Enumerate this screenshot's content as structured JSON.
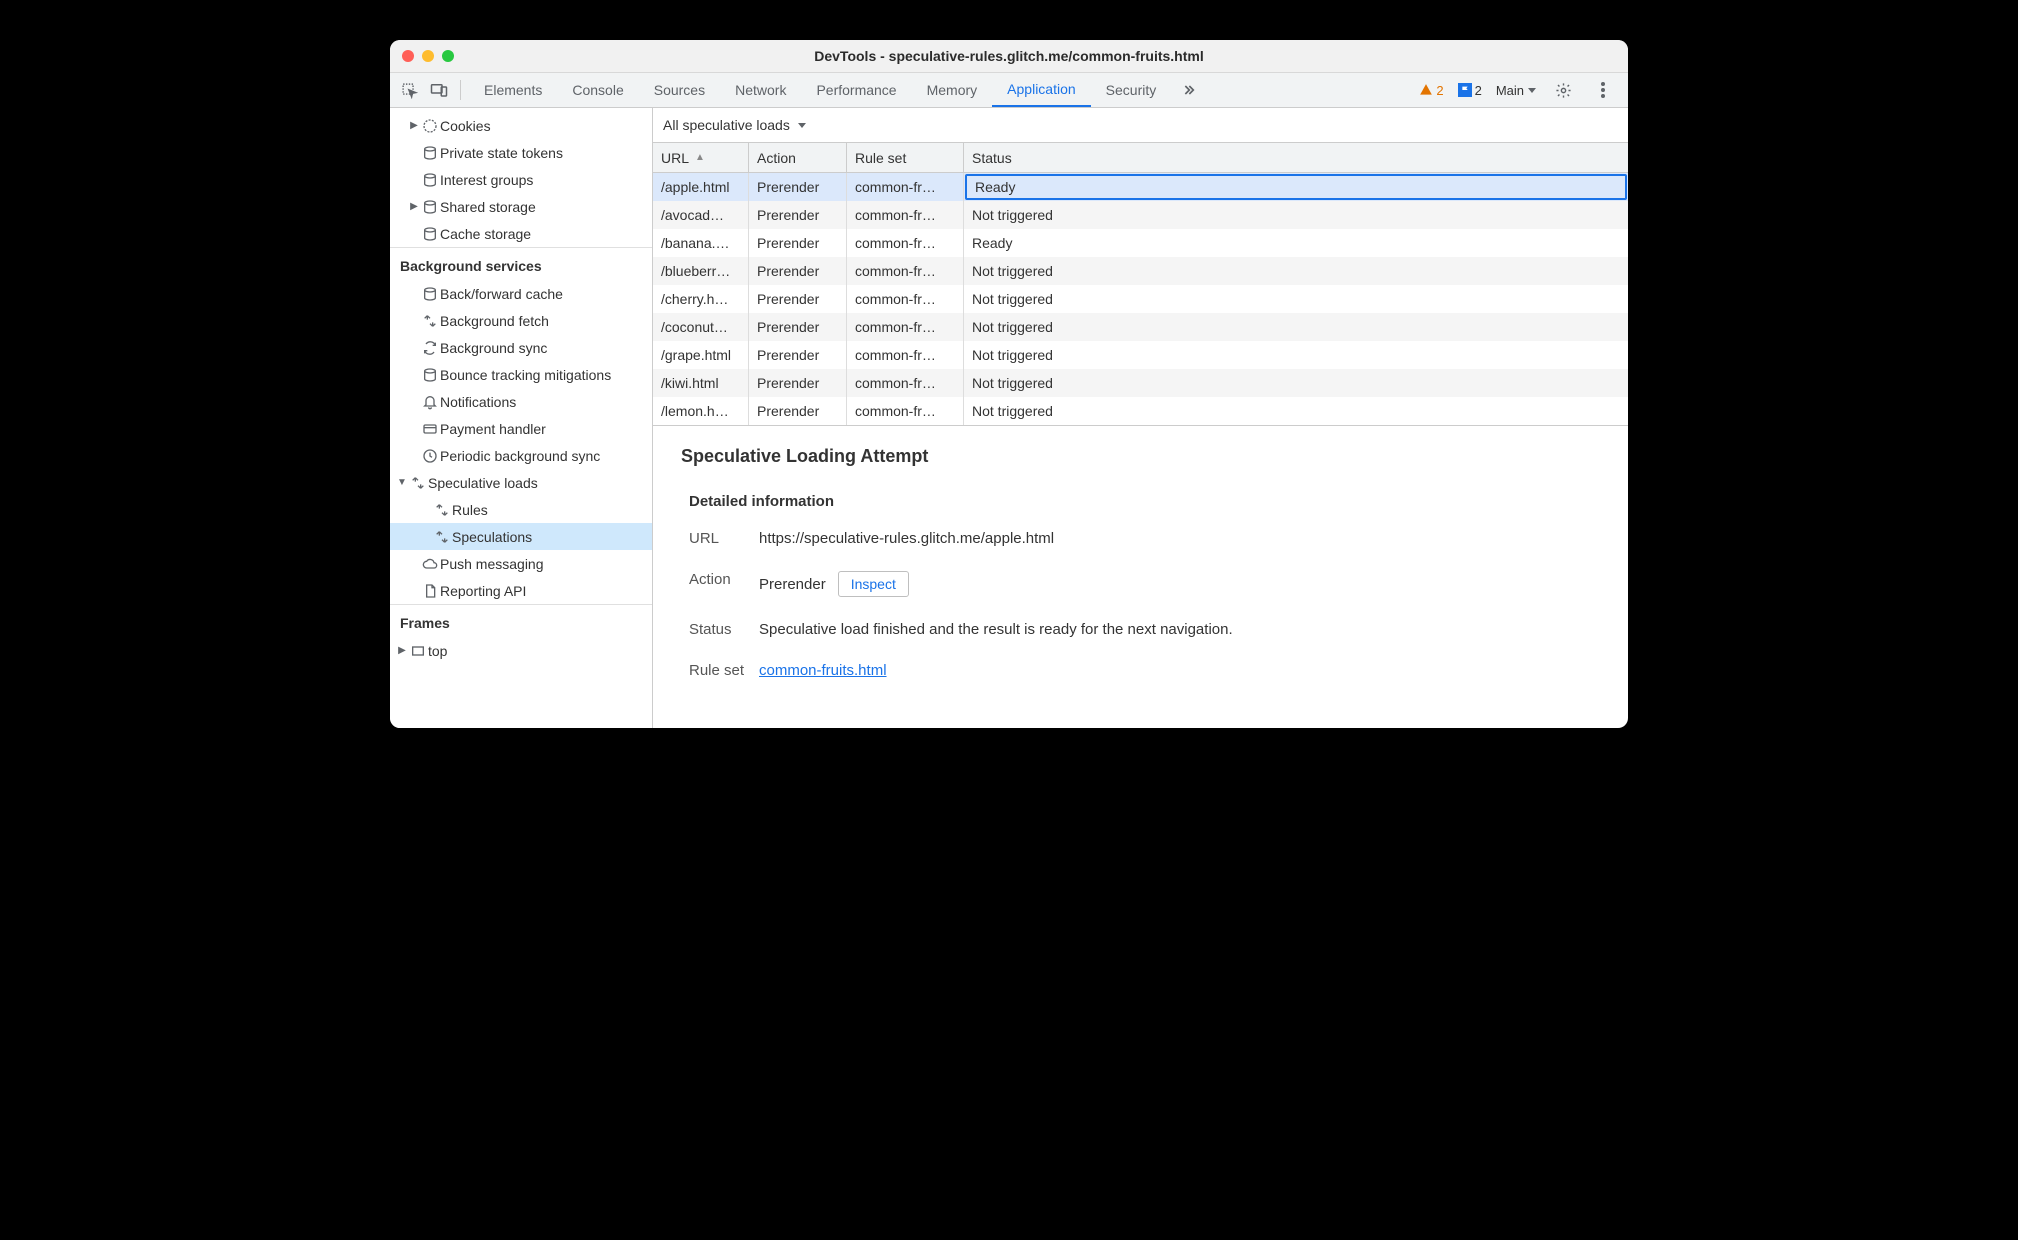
{
  "window": {
    "title": "DevTools - speculative-rules.glitch.me/common-fruits.html"
  },
  "tabbar": {
    "tabs": [
      "Elements",
      "Console",
      "Sources",
      "Network",
      "Performance",
      "Memory",
      "Application",
      "Security"
    ],
    "active_index": 6,
    "warnings_count": "2",
    "issues_count": "2",
    "target": "Main"
  },
  "sidebar": {
    "storage": {
      "cookies": "Cookies",
      "pst": "Private state tokens",
      "interest": "Interest groups",
      "shared": "Shared storage",
      "cache": "Cache storage"
    },
    "bg_header": "Background services",
    "bg": {
      "bfcache": "Back/forward cache",
      "bgfetch": "Background fetch",
      "bgsync": "Background sync",
      "bounce": "Bounce tracking mitigations",
      "notif": "Notifications",
      "payment": "Payment handler",
      "periodic": "Periodic background sync",
      "specloads": "Speculative loads",
      "rules": "Rules",
      "speculations": "Speculations",
      "push": "Push messaging",
      "reporting": "Reporting API"
    },
    "frames_header": "Frames",
    "frames_top": "top"
  },
  "filter": {
    "label": "All speculative loads"
  },
  "table": {
    "columns": {
      "url": "URL",
      "action": "Action",
      "ruleset": "Rule set",
      "status": "Status"
    },
    "rows": [
      {
        "url": "/apple.html",
        "action": "Prerender",
        "ruleset": "common-fr…",
        "status": "Ready",
        "selected": true
      },
      {
        "url": "/avocad…",
        "action": "Prerender",
        "ruleset": "common-fr…",
        "status": "Not triggered"
      },
      {
        "url": "/banana.…",
        "action": "Prerender",
        "ruleset": "common-fr…",
        "status": "Ready"
      },
      {
        "url": "/blueberr…",
        "action": "Prerender",
        "ruleset": "common-fr…",
        "status": "Not triggered"
      },
      {
        "url": "/cherry.h…",
        "action": "Prerender",
        "ruleset": "common-fr…",
        "status": "Not triggered"
      },
      {
        "url": "/coconut…",
        "action": "Prerender",
        "ruleset": "common-fr…",
        "status": "Not triggered"
      },
      {
        "url": "/grape.html",
        "action": "Prerender",
        "ruleset": "common-fr…",
        "status": "Not triggered"
      },
      {
        "url": "/kiwi.html",
        "action": "Prerender",
        "ruleset": "common-fr…",
        "status": "Not triggered"
      },
      {
        "url": "/lemon.h…",
        "action": "Prerender",
        "ruleset": "common-fr…",
        "status": "Not triggered"
      }
    ]
  },
  "details": {
    "heading": "Speculative Loading Attempt",
    "subheading": "Detailed information",
    "url_label": "URL",
    "url_value": "https://speculative-rules.glitch.me/apple.html",
    "action_label": "Action",
    "action_value": "Prerender",
    "inspect_btn": "Inspect",
    "status_label": "Status",
    "status_value": "Speculative load finished and the result is ready for the next navigation.",
    "ruleset_label": "Rule set",
    "ruleset_link": "common-fruits.html"
  }
}
